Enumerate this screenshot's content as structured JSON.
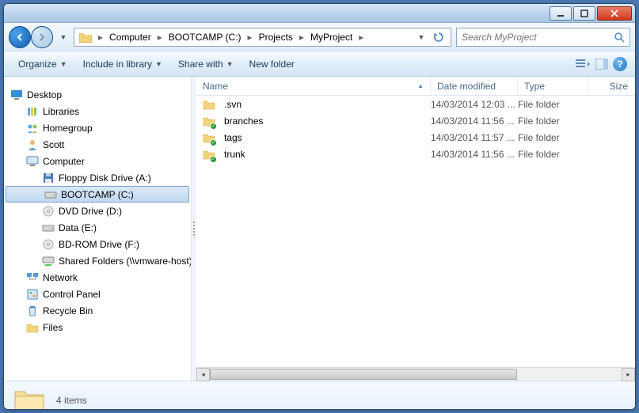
{
  "breadcrumb": {
    "items": [
      "Computer",
      "BOOTCAMP (C:)",
      "Projects",
      "MyProject"
    ]
  },
  "search": {
    "placeholder": "Search MyProject"
  },
  "toolbar": {
    "organize": "Organize",
    "include": "Include in library",
    "share": "Share with",
    "newfolder": "New folder"
  },
  "columns": {
    "name": "Name",
    "date": "Date modified",
    "type": "Type",
    "size": "Size"
  },
  "sidebar": {
    "desktop": "Desktop",
    "libraries": "Libraries",
    "homegroup": "Homegroup",
    "scott": "Scott",
    "computer": "Computer",
    "floppy": "Floppy Disk Drive (A:)",
    "bootcamp": "BOOTCAMP (C:)",
    "dvd": "DVD Drive (D:)",
    "data": "Data (E:)",
    "bdrom": "BD-ROM Drive (F:)",
    "shared": "Shared Folders (\\\\vmware-host)",
    "network": "Network",
    "cpanel": "Control Panel",
    "recycle": "Recycle Bin",
    "files": "Files"
  },
  "files": [
    {
      "name": ".svn",
      "date": "14/03/2014 12:03 ...",
      "type": "File folder",
      "overlay": false
    },
    {
      "name": "branches",
      "date": "14/03/2014 11:56 ...",
      "type": "File folder",
      "overlay": true
    },
    {
      "name": "tags",
      "date": "14/03/2014 11:57 ...",
      "type": "File folder",
      "overlay": true
    },
    {
      "name": "trunk",
      "date": "14/03/2014 11:56 ...",
      "type": "File folder",
      "overlay": true
    }
  ],
  "status": {
    "count": "4 items"
  }
}
